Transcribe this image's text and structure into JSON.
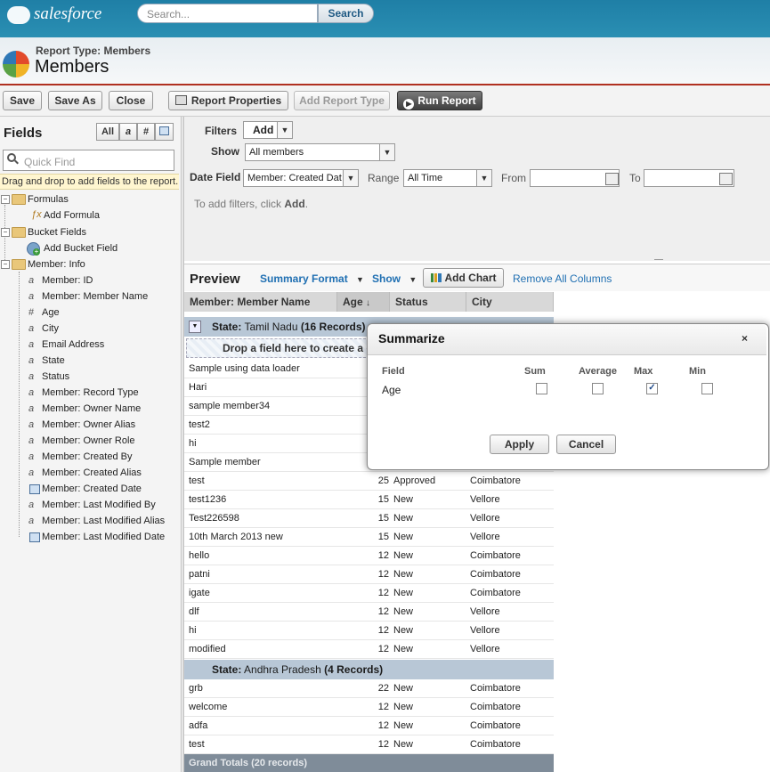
{
  "header": {
    "logo_text": "salesforce",
    "search_placeholder": "Search...",
    "search_button": "Search",
    "report_type": "Report Type: Members",
    "page_title": "Members"
  },
  "toolbar": {
    "save": "Save",
    "save_as": "Save As",
    "close": "Close",
    "report_properties": "Report Properties",
    "add_report_type": "Add Report Type",
    "run_report": "Run Report"
  },
  "fields_panel": {
    "title": "Fields",
    "filter_all": "All",
    "quick_find_placeholder": "Quick Find",
    "drag_note": "Drag and drop to add fields to the report.",
    "formulas": "Formulas",
    "add_formula": "Add Formula",
    "bucket_fields": "Bucket Fields",
    "add_bucket_field": "Add Bucket Field",
    "member_info": "Member: Info",
    "fields": [
      {
        "label": "Member: ID",
        "icon": "text"
      },
      {
        "label": "Member: Member Name",
        "icon": "text"
      },
      {
        "label": "Age",
        "icon": "number"
      },
      {
        "label": "City",
        "icon": "text"
      },
      {
        "label": "Email Address",
        "icon": "text"
      },
      {
        "label": "State",
        "icon": "text"
      },
      {
        "label": "Status",
        "icon": "text"
      },
      {
        "label": "Member: Record Type",
        "icon": "text"
      },
      {
        "label": "Member: Owner Name",
        "icon": "text"
      },
      {
        "label": "Member: Owner Alias",
        "icon": "text"
      },
      {
        "label": "Member: Owner Role",
        "icon": "text"
      },
      {
        "label": "Member: Created By",
        "icon": "text"
      },
      {
        "label": "Member: Created Alias",
        "icon": "text"
      },
      {
        "label": "Member: Created Date",
        "icon": "date"
      },
      {
        "label": "Member: Last Modified By",
        "icon": "text"
      },
      {
        "label": "Member: Last Modified Alias",
        "icon": "text"
      },
      {
        "label": "Member: Last Modified Date",
        "icon": "date"
      }
    ]
  },
  "filters": {
    "filters_label": "Filters",
    "add_button": "Add",
    "show_label": "Show",
    "show_value": "All members",
    "date_field_label": "Date Field",
    "date_field_value": "Member: Created Dat",
    "range_label": "Range",
    "range_value": "All Time",
    "from_label": "From",
    "to_label": "To",
    "hint_prefix": "To add filters, click ",
    "hint_bold": "Add",
    "hint_suffix": "."
  },
  "preview": {
    "title": "Preview",
    "summary_format": "Summary Format",
    "show": "Show",
    "add_chart": "Add Chart",
    "remove_all_columns": "Remove All Columns",
    "columns": [
      "Member: Member Name",
      "Age",
      "Status",
      "City"
    ],
    "group1": {
      "label": "State:",
      "value": "Tamil Nadu",
      "count": "(16 Records)"
    },
    "drop_field": "Drop a field here to create a g",
    "group1_rows": [
      {
        "name": "Sample using data loader",
        "age": "",
        "status": "",
        "city": ""
      },
      {
        "name": "Hari",
        "age": "",
        "status": "",
        "city": ""
      },
      {
        "name": "sample member34",
        "age": "",
        "status": "",
        "city": ""
      },
      {
        "name": "test2",
        "age": "",
        "status": "",
        "city": ""
      },
      {
        "name": "hi",
        "age": "",
        "status": "",
        "city": ""
      },
      {
        "name": "Sample member",
        "age": "",
        "status": "",
        "city": ""
      },
      {
        "name": "test",
        "age": "25",
        "status": "Approved",
        "city": "Coimbatore"
      },
      {
        "name": "test1236",
        "age": "15",
        "status": "New",
        "city": "Vellore"
      },
      {
        "name": "Test226598",
        "age": "15",
        "status": "New",
        "city": "Vellore"
      },
      {
        "name": "10th March 2013 new",
        "age": "15",
        "status": "New",
        "city": "Vellore"
      },
      {
        "name": "hello",
        "age": "12",
        "status": "New",
        "city": "Coimbatore"
      },
      {
        "name": "patni",
        "age": "12",
        "status": "New",
        "city": "Coimbatore"
      },
      {
        "name": "igate",
        "age": "12",
        "status": "New",
        "city": "Coimbatore"
      },
      {
        "name": "dlf",
        "age": "12",
        "status": "New",
        "city": "Vellore"
      },
      {
        "name": "hi",
        "age": "12",
        "status": "New",
        "city": "Vellore"
      },
      {
        "name": "modified",
        "age": "12",
        "status": "New",
        "city": "Vellore"
      }
    ],
    "group2": {
      "label": "State:",
      "value": "Andhra Pradesh",
      "count": "(4 Records)"
    },
    "group2_rows": [
      {
        "name": "grb",
        "age": "22",
        "status": "New",
        "city": "Coimbatore"
      },
      {
        "name": "welcome",
        "age": "12",
        "status": "New",
        "city": "Coimbatore"
      },
      {
        "name": "adfa",
        "age": "12",
        "status": "New",
        "city": "Coimbatore"
      },
      {
        "name": "test",
        "age": "12",
        "status": "New",
        "city": "Coimbatore"
      }
    ],
    "grand_totals": "Grand Totals (20 records)"
  },
  "modal": {
    "title": "Summarize",
    "close": "×",
    "col_field": "Field",
    "col_sum": "Sum",
    "col_average": "Average",
    "col_max": "Max",
    "col_min": "Min",
    "field_name": "Age",
    "sum_checked": false,
    "average_checked": false,
    "max_checked": true,
    "min_checked": false,
    "apply": "Apply",
    "cancel": "Cancel"
  },
  "colors": {
    "header_blue": "#1f7fa6",
    "group_row": "#b8c7d6",
    "link": "#1f6fb2",
    "accent_red": "#b03020"
  }
}
